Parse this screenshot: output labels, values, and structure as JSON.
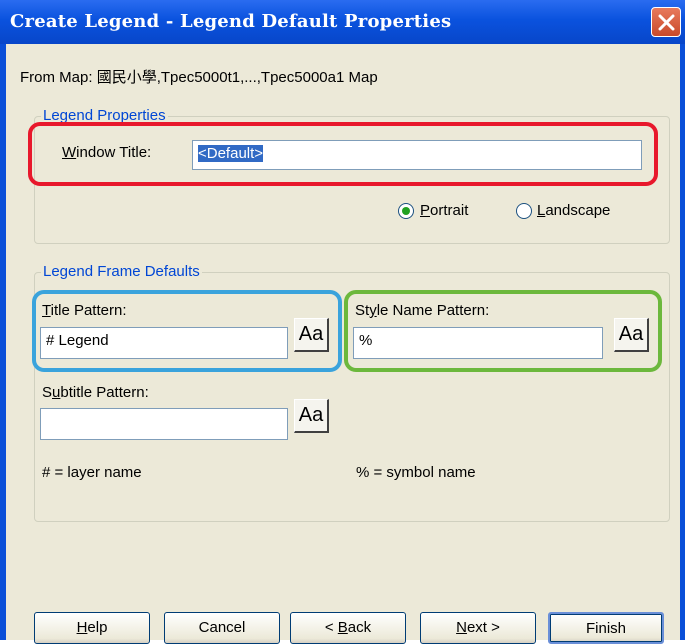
{
  "window": {
    "title": "Create Legend - Legend Default Properties"
  },
  "from_map": {
    "label": "From Map:",
    "value": "國民小學,Tpec5000t1,...,Tpec5000a1 Map"
  },
  "legend_properties": {
    "group_label": "Legend Properties",
    "window_title_label_u": "W",
    "window_title_label_rest": "indow Title:",
    "window_title_value": "<Default>",
    "portrait_u": "P",
    "portrait_rest": "ortrait",
    "landscape_u": "L",
    "landscape_rest": "andscape",
    "orientation_selected": "Portrait"
  },
  "legend_frame_defaults": {
    "group_label": "Legend Frame Defaults",
    "title_pattern_label_u": "T",
    "title_pattern_label_rest": "itle Pattern:",
    "title_pattern_value": "# Legend",
    "style_name_label_pre": "St",
    "style_name_label_u": "y",
    "style_name_label_rest": "le Name Pattern:",
    "style_name_value": "%",
    "subtitle_label_pre": "S",
    "subtitle_label_u": "u",
    "subtitle_label_rest": "btitle Pattern:",
    "subtitle_value": "",
    "aa_label": "Aa",
    "hint_layer": "# = layer name",
    "hint_symbol": "% = symbol name"
  },
  "buttons": {
    "help_u": "H",
    "help_rest": "elp",
    "cancel": "Cancel",
    "back_pre": "< ",
    "back_u": "B",
    "back_rest": "ack",
    "next_u": "N",
    "next_rest": "ext >",
    "finish": "Finish"
  },
  "colors": {
    "highlight_red": "#e8182c",
    "highlight_blue": "#3aa3dc",
    "highlight_green": "#6cb83c"
  }
}
